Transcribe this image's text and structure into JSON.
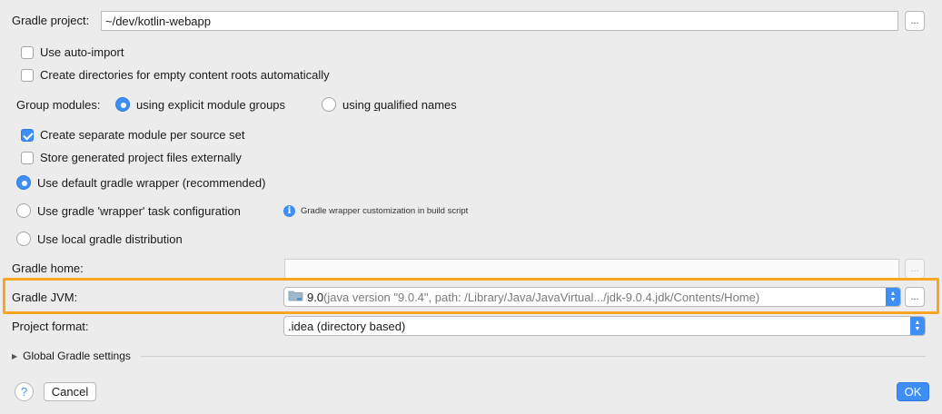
{
  "gradle_project": {
    "label": "Gradle project:",
    "value": "~/dev/kotlin-webapp",
    "browse_label": "..."
  },
  "options": {
    "auto_import": {
      "label": "Use auto-import",
      "checked": false
    },
    "create_dirs": {
      "label": "Create directories for empty content roots automatically",
      "checked": false
    }
  },
  "group_modules": {
    "label": "Group modules:",
    "option_explicit": "using explicit module groups",
    "option_qualified_pre": "using ",
    "option_qualified_ul": "q",
    "option_qualified_post": "ualified names",
    "selected": "explicit"
  },
  "module_options": {
    "separate_module": {
      "label": "Create separate module per source set",
      "checked": true
    },
    "store_external": {
      "label": "Store generated project files externally",
      "checked": false
    }
  },
  "distribution": {
    "default_wrapper": "Use default gradle wrapper (recommended)",
    "wrapper_task": "Use gradle 'wrapper' task configuration",
    "wrapper_hint": "Gradle wrapper customization in build script",
    "local": "Use local gradle distribution",
    "selected": "default_wrapper"
  },
  "gradle_home": {
    "label": "Gradle home:",
    "value": "",
    "browse_label": "..."
  },
  "gradle_jvm": {
    "label": "Gradle JVM:",
    "version": "9.0",
    "detail": " (java version \"9.0.4\", path: /Library/Java/JavaVirtual.../jdk-9.0.4.jdk/Contents/Home)",
    "browse_label": "...",
    "highlight_color": "#f6a623"
  },
  "project_format": {
    "label": "Project format:",
    "value": ".idea (directory based)"
  },
  "global_settings": {
    "label": "Global Gradle settings"
  },
  "footer": {
    "help_label": "?",
    "cancel_label": "Cancel",
    "ok_label": "OK"
  },
  "colors": {
    "accent": "#3d8ff5",
    "background": "#ececec"
  }
}
